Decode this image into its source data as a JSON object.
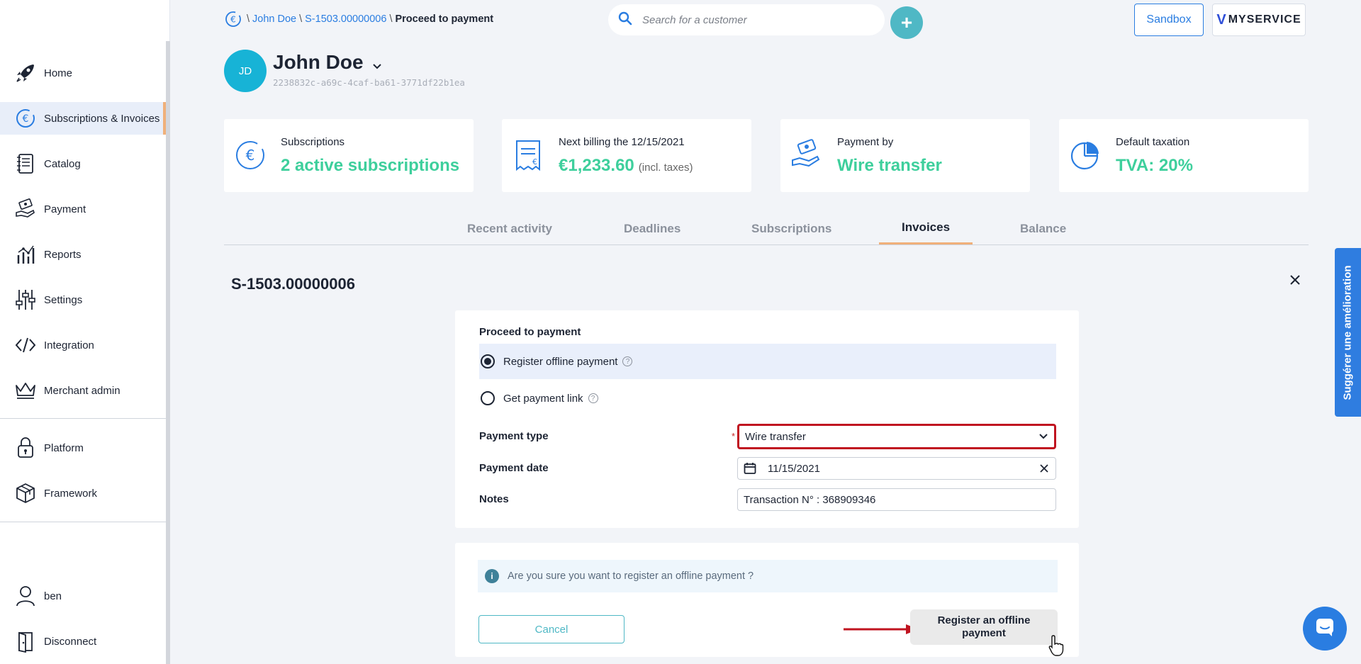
{
  "breadcrumb": {
    "customer": "John Doe",
    "invoice": "S-1503.00000006",
    "current": "Proceed to payment",
    "sep": "\\"
  },
  "search": {
    "placeholder": "Search for a customer"
  },
  "header": {
    "sandbox_label": "Sandbox",
    "brand_label": "MYSERVICE",
    "brand_mark": "V",
    "add_label": "+"
  },
  "sidebar": {
    "items": [
      {
        "label": "Home",
        "icon": "rocket-icon"
      },
      {
        "label": "Subscriptions & Invoices",
        "icon": "euro-refresh-icon"
      },
      {
        "label": "Catalog",
        "icon": "notebook-icon"
      },
      {
        "label": "Payment",
        "icon": "hand-money-icon"
      },
      {
        "label": "Reports",
        "icon": "bar-chart-icon"
      },
      {
        "label": "Settings",
        "icon": "sliders-icon"
      },
      {
        "label": "Integration",
        "icon": "code-icon"
      },
      {
        "label": "Merchant admin",
        "icon": "crown-icon"
      },
      {
        "label": "Platform",
        "icon": "lock-icon"
      },
      {
        "label": "Framework",
        "icon": "box-icon"
      },
      {
        "label": "ben",
        "icon": "user-icon"
      },
      {
        "label": "Disconnect",
        "icon": "door-icon"
      }
    ]
  },
  "customer": {
    "initials": "JD",
    "name": "John Doe",
    "id": "2238832c-a69c-4caf-ba61-3771df22b1ea"
  },
  "cards": [
    {
      "label": "Subscriptions",
      "value": "2 active subscriptions",
      "sub": "",
      "icon": "euro-circle-icon"
    },
    {
      "label": "Next billing the 12/15/2021",
      "value": "€1,233.60",
      "sub": "(incl. taxes)",
      "icon": "receipt-icon"
    },
    {
      "label": "Payment by",
      "value": "Wire transfer",
      "sub": "",
      "icon": "hand-money-icon"
    },
    {
      "label": "Default taxation",
      "value": "TVA: 20%",
      "sub": "",
      "icon": "pie-chart-icon"
    }
  ],
  "tabs": [
    {
      "label": "Recent activity"
    },
    {
      "label": "Deadlines"
    },
    {
      "label": "Subscriptions"
    },
    {
      "label": "Invoices",
      "active": true
    },
    {
      "label": "Balance"
    }
  ],
  "invoice_title": "S-1503.00000006",
  "form": {
    "heading": "Proceed to payment",
    "option_offline": "Register offline payment",
    "option_link": "Get payment link",
    "selected_option": "Register offline payment",
    "payment_type_label": "Payment type",
    "required_mark": "*",
    "payment_type_value": "Wire transfer",
    "payment_date_label": "Payment date",
    "payment_date_value": "11/15/2021",
    "notes_label": "Notes",
    "notes_value": "Transaction N° : 368909346",
    "help_glyph": "?"
  },
  "confirm": {
    "info_glyph": "i",
    "message": "Are you sure you want to register an offline payment ?",
    "cancel_label": "Cancel",
    "register_label": "Register an offline payment"
  },
  "suggest_label": "Suggérer une amélioration",
  "colors": {
    "accent": "#2a7de1",
    "teal": "#4fb8c5",
    "value_green": "#3ecf9c",
    "active_tab": "#f0b07a",
    "highlight_red": "#c01420"
  }
}
